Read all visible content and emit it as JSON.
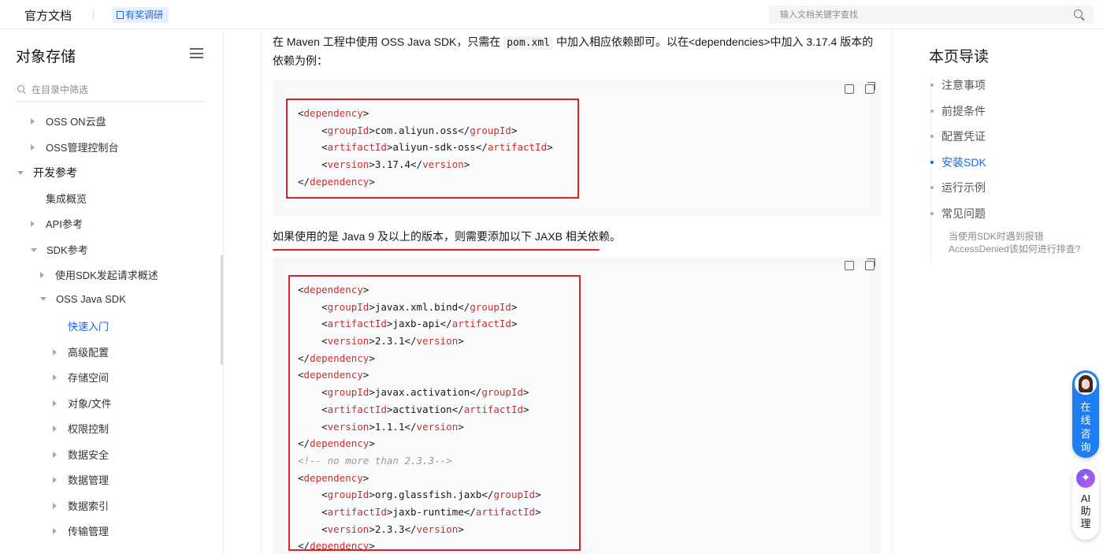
{
  "topbar": {
    "brand": "官方文档",
    "survey_label": "有奖调研",
    "search_placeholder": "输入文档关键字查找"
  },
  "sidebar": {
    "title": "对象存储",
    "filter_placeholder": "在目录中筛选",
    "items": [
      {
        "label": "OSS ON云盘",
        "level": 1,
        "expander": "collapsed"
      },
      {
        "label": "OSS管理控制台",
        "level": 1,
        "expander": "collapsed"
      },
      {
        "label": "开发参考",
        "level": 0,
        "expander": "expanded"
      },
      {
        "label": "集成概览",
        "level": 1,
        "expander": "none"
      },
      {
        "label": "API参考",
        "level": 1,
        "expander": "collapsed"
      },
      {
        "label": "SDK参考",
        "level": 1,
        "expander": "expanded"
      },
      {
        "label": "使用SDK发起请求概述",
        "level": 2,
        "expander": "collapsed"
      },
      {
        "label": "OSS Java SDK",
        "level": 2,
        "expander": "expanded"
      },
      {
        "label": "快速入门",
        "level": 3,
        "expander": "none",
        "active": true
      },
      {
        "label": "高级配置",
        "level": 3,
        "expander": "collapsed"
      },
      {
        "label": "存储空间",
        "level": 3,
        "expander": "collapsed"
      },
      {
        "label": "对象/文件",
        "level": 3,
        "expander": "collapsed"
      },
      {
        "label": "权限控制",
        "level": 3,
        "expander": "collapsed"
      },
      {
        "label": "数据安全",
        "level": 3,
        "expander": "collapsed"
      },
      {
        "label": "数据管理",
        "level": 3,
        "expander": "collapsed"
      },
      {
        "label": "数据索引",
        "level": 3,
        "expander": "collapsed"
      },
      {
        "label": "传输管理",
        "level": 3,
        "expander": "collapsed"
      }
    ]
  },
  "content": {
    "intro": {
      "before_code": "在 Maven 工程中使用 OSS Java SDK，只需在 ",
      "code": "pom.xml",
      "after_code": " 中加入相应依赖即可。以在<dependencies>中加入 3.17.4 版本的依赖为例："
    },
    "code1": [
      [
        [
          "t",
          "<"
        ],
        [
          "k",
          "dependency"
        ],
        [
          "t",
          ">"
        ]
      ],
      [
        [
          "t",
          "    <"
        ],
        [
          "k",
          "groupId"
        ],
        [
          "t",
          ">com.aliyun.oss</"
        ],
        [
          "k",
          "groupId"
        ],
        [
          "t",
          ">"
        ]
      ],
      [
        [
          "t",
          "    <"
        ],
        [
          "k",
          "artifactId"
        ],
        [
          "t",
          ">aliyun-sdk-oss</"
        ],
        [
          "k",
          "artifactId"
        ],
        [
          "t",
          ">"
        ]
      ],
      [
        [
          "t",
          "    <"
        ],
        [
          "k",
          "version"
        ],
        [
          "t",
          ">3.17.4</"
        ],
        [
          "k",
          "version"
        ],
        [
          "t",
          ">"
        ]
      ],
      [
        [
          "t",
          "</"
        ],
        [
          "k",
          "dependency"
        ],
        [
          "t",
          ">"
        ]
      ]
    ],
    "note": "如果使用的是 Java 9 及以上的版本，则需要添加以下 JAXB 相关依赖。",
    "code2": [
      [
        [
          "t",
          "<"
        ],
        [
          "k",
          "dependency"
        ],
        [
          "t",
          ">"
        ]
      ],
      [
        [
          "t",
          "    <"
        ],
        [
          "k",
          "groupId"
        ],
        [
          "t",
          ">javax.xml.bind</"
        ],
        [
          "k",
          "groupId"
        ],
        [
          "t",
          ">"
        ]
      ],
      [
        [
          "t",
          "    <"
        ],
        [
          "k",
          "artifactId"
        ],
        [
          "t",
          ">jaxb-api</"
        ],
        [
          "k",
          "artifactId"
        ],
        [
          "t",
          ">"
        ]
      ],
      [
        [
          "t",
          "    <"
        ],
        [
          "k",
          "version"
        ],
        [
          "t",
          ">2.3.1</"
        ],
        [
          "k",
          "version"
        ],
        [
          "t",
          ">"
        ]
      ],
      [
        [
          "t",
          "</"
        ],
        [
          "k",
          "dependency"
        ],
        [
          "t",
          ">"
        ]
      ],
      [
        [
          "t",
          "<"
        ],
        [
          "k",
          "dependency"
        ],
        [
          "t",
          ">"
        ]
      ],
      [
        [
          "t",
          "    <"
        ],
        [
          "k",
          "groupId"
        ],
        [
          "t",
          ">javax.activation</"
        ],
        [
          "k",
          "groupId"
        ],
        [
          "t",
          ">"
        ]
      ],
      [
        [
          "t",
          "    <"
        ],
        [
          "k",
          "artifactId"
        ],
        [
          "t",
          ">activation</"
        ],
        [
          "k",
          "artifactId"
        ],
        [
          "t",
          ">"
        ]
      ],
      [
        [
          "t",
          "    <"
        ],
        [
          "k",
          "version"
        ],
        [
          "t",
          ">1.1.1</"
        ],
        [
          "k",
          "version"
        ],
        [
          "t",
          ">"
        ]
      ],
      [
        [
          "t",
          "</"
        ],
        [
          "k",
          "dependency"
        ],
        [
          "t",
          ">"
        ]
      ],
      [
        [
          "c",
          "<!-- no more than 2.3.3-->"
        ]
      ],
      [
        [
          "t",
          "<"
        ],
        [
          "k",
          "dependency"
        ],
        [
          "t",
          ">"
        ]
      ],
      [
        [
          "t",
          "    <"
        ],
        [
          "k",
          "groupId"
        ],
        [
          "t",
          ">org.glassfish.jaxb</"
        ],
        [
          "k",
          "groupId"
        ],
        [
          "t",
          ">"
        ]
      ],
      [
        [
          "t",
          "    <"
        ],
        [
          "k",
          "artifactId"
        ],
        [
          "t",
          ">jaxb-runtime</"
        ],
        [
          "k",
          "artifactId"
        ],
        [
          "t",
          ">"
        ]
      ],
      [
        [
          "t",
          "    <"
        ],
        [
          "k",
          "version"
        ],
        [
          "t",
          ">2.3.3</"
        ],
        [
          "k",
          "version"
        ],
        [
          "t",
          ">"
        ]
      ],
      [
        [
          "t",
          "</"
        ],
        [
          "k",
          "dependency"
        ],
        [
          "t",
          ">"
        ]
      ]
    ]
  },
  "toc": {
    "title": "本页导读",
    "items": [
      {
        "label": "注意事项"
      },
      {
        "label": "前提条件"
      },
      {
        "label": "配置凭证"
      },
      {
        "label": "安装SDK",
        "active": true
      },
      {
        "label": "运行示例"
      },
      {
        "label": "常见问题"
      }
    ],
    "sub_item": "当使用SDK时遇到报错AccessDenied该如何进行排查?"
  },
  "widgets": {
    "consult_label": "在线咨询",
    "ai_label": "AI助理"
  },
  "colors": {
    "accent": "#1a66e0",
    "code_tag": "#c9302c",
    "annotation_red": "#e02020"
  }
}
